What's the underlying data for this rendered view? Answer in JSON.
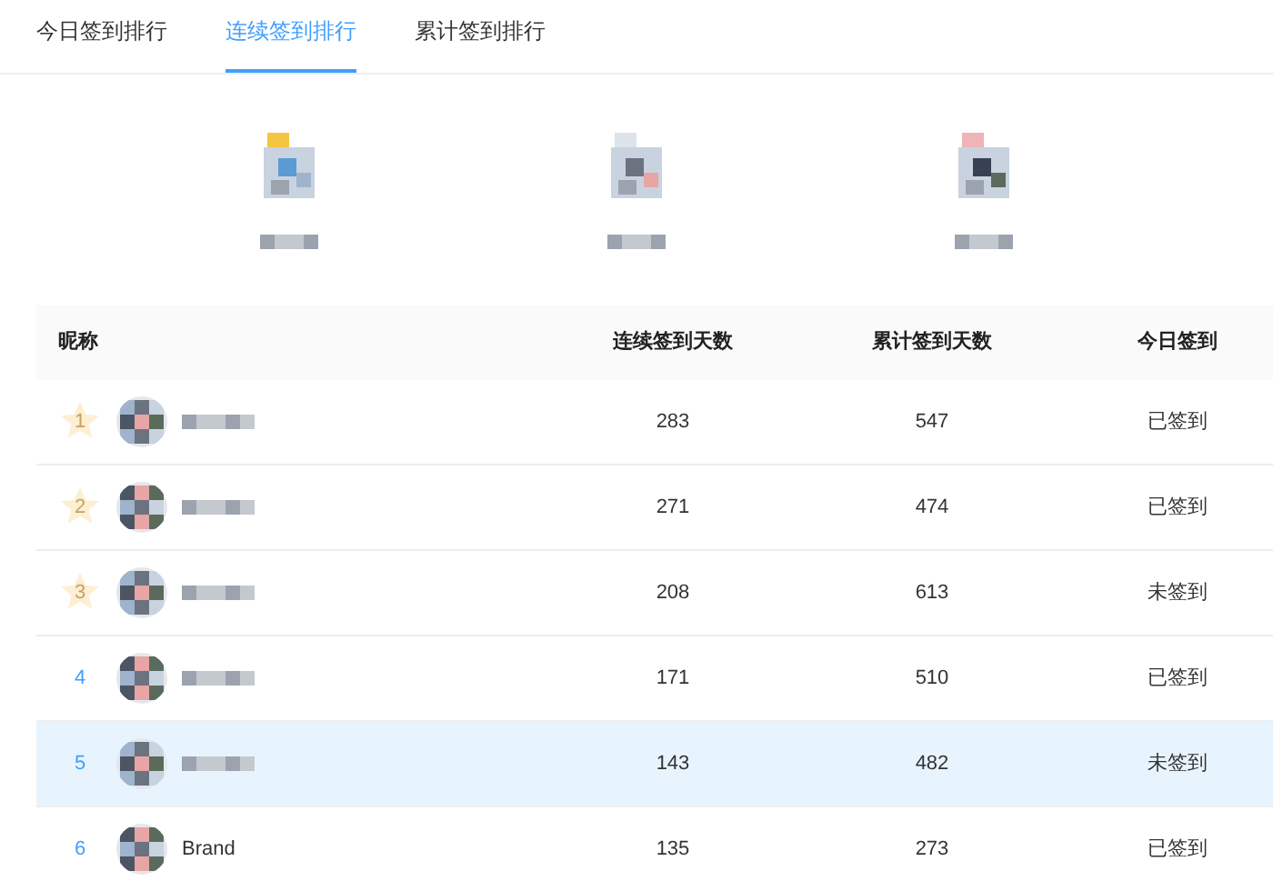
{
  "tabs": [
    {
      "label": "今日签到排行",
      "selected": false
    },
    {
      "label": "连续签到排行",
      "selected": true
    },
    {
      "label": "累计签到排行",
      "selected": false
    }
  ],
  "table": {
    "columns": [
      "昵称",
      "连续签到天数",
      "累计签到天数",
      "今日签到"
    ],
    "rows": [
      {
        "rank": "1",
        "kind": "star",
        "selected": false,
        "name": null,
        "streak": "283",
        "total": "547",
        "today": "已签到"
      },
      {
        "rank": "2",
        "kind": "star",
        "selected": false,
        "name": null,
        "streak": "271",
        "total": "474",
        "today": "已签到"
      },
      {
        "rank": "3",
        "kind": "star",
        "selected": false,
        "name": null,
        "streak": "208",
        "total": "613",
        "today": "未签到"
      },
      {
        "rank": "4",
        "kind": "plain",
        "selected": false,
        "name": null,
        "streak": "171",
        "total": "510",
        "today": "已签到"
      },
      {
        "rank": "5",
        "kind": "plain",
        "selected": true,
        "name": null,
        "streak": "143",
        "total": "482",
        "today": "未签到"
      },
      {
        "rank": "6",
        "kind": "plain",
        "selected": false,
        "name": "Brand",
        "streak": "135",
        "total": "273",
        "today": "已签到"
      }
    ]
  }
}
